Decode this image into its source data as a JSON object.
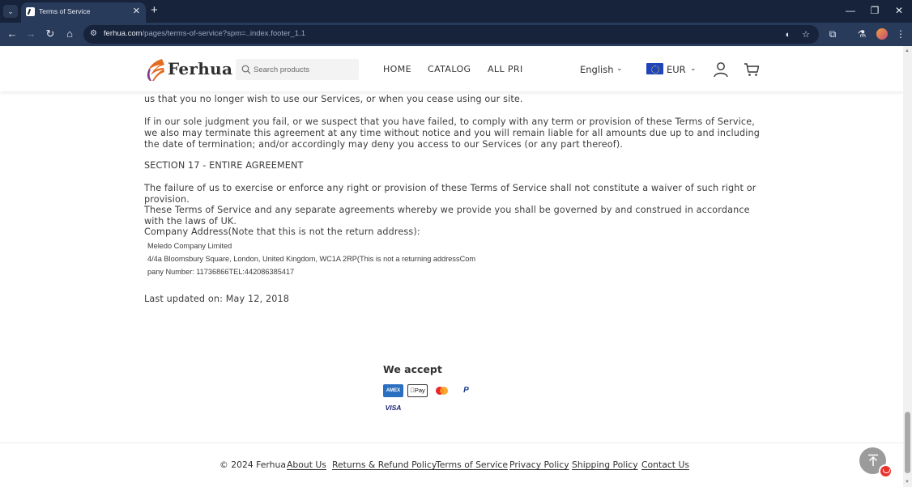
{
  "browser": {
    "tab_title": "Terms of Service",
    "url_host": "ferhua.com",
    "url_path": "/pages/terms-of-service?spm=..index.footer_1.1",
    "icons": [
      "tab-search-icon",
      "close-icon",
      "plus-icon",
      "minimize-icon",
      "restore-icon",
      "close-window-icon",
      "back-arrow-icon",
      "forward-arrow-icon",
      "reload-icon",
      "home-icon",
      "site-info-icon",
      "eye-off-icon",
      "star-icon",
      "extensions-icon",
      "lab-icon",
      "profile-avatar-icon",
      "kebab-menu-icon"
    ],
    "glyphs": {
      "tab_search": "⌄",
      "tab_close": "✕",
      "new_tab": "+",
      "minimize": "—",
      "restore": "❐",
      "close_window": "✕",
      "back": "←",
      "forward": "→",
      "reload": "↻",
      "home": "⌂",
      "site_info": "⚙",
      "eye_off": "◐",
      "star": "☆",
      "extensions": "⧉",
      "lab": "⚗",
      "menu": "⋮"
    }
  },
  "header": {
    "logo_text": "Ferhua",
    "search_placeholder": "Search products",
    "menu": [
      "HOME",
      "CATALOG",
      "ALL PRI"
    ],
    "language": "English",
    "currency": "EUR",
    "chevron": "⌄"
  },
  "content": {
    "para_cut": "us that you no longer wish to use our Services, or when you cease using our site.",
    "para_1": "If in our sole judgment you fail, or we suspect that you have failed, to comply with any term or provision of these Terms of Service, we also may terminate this agreement at any time without notice and you will remain liable for all amounts due up to and including the date of termination; and/or accordingly may deny you access to our Services (or any part thereof).",
    "section_heading": "SECTION 17 - ENTIRE AGREEMENT",
    "para_2": "The failure of us to exercise or enforce any right or provision of these Terms of Service shall not constitute a waiver of such right or provision.",
    "para_3": "These Terms of Service and any separate agreements whereby we provide you shall be governed by and construed in accordance with the laws of UK.",
    "address_heading": "Company Address(Note that this is not the return address):",
    "address_line_1": "Meledo Company Limited",
    "address_line_2": "4/4a Bloomsbury Square, London, United Kingdom, WC1A 2RP(This is not a returning addressCom",
    "address_line_3": "pany Number: 11736866TEL:442086385417",
    "last_updated": "Last updated on: May 12, 2018"
  },
  "payments": {
    "heading": "We accept",
    "methods": [
      "AMEX",
      "Pay",
      "Mastercard",
      "P",
      "VISA"
    ]
  },
  "footer": {
    "copyright": "© 2024 Ferhua",
    "links": [
      "About Us",
      "Returns & Refund Policy",
      "Terms of Service",
      "Privacy Policy",
      "Shipping Policy",
      "Contact Us"
    ]
  },
  "colors": {
    "chrome_dark": "#16233a",
    "chrome_toolbar": "#293b5a",
    "text": "#3c3c3c",
    "flag_blue": "#1f45b8",
    "badge_red": "#e8332c"
  }
}
